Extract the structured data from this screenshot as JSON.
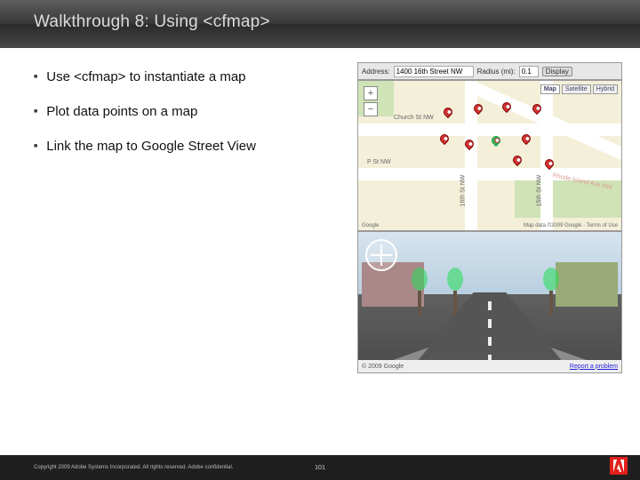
{
  "header": {
    "title": "Walkthrough 8: Using <cfmap>"
  },
  "bullets": [
    "Use <cfmap> to instantiate a map",
    "Plot data points on a map",
    "Link the map to Google Street View"
  ],
  "figure": {
    "addressBar": {
      "addrLabel": "Address:",
      "addrValue": "1400 16th Street NW",
      "radiusLabel": "Radius (mi):",
      "radiusValue": "0.1",
      "displayBtn": "Display"
    },
    "mapTypes": {
      "map": "Map",
      "satellite": "Satellite",
      "hybrid": "Hybrid"
    },
    "mapControls": {
      "plus": "+",
      "minus": "−"
    },
    "roads": {
      "church": "Church St NW",
      "pst": "P St NW",
      "sixteenth": "16th St NW",
      "fifteenth": "15th St NW",
      "rhode": "Rhode Island Ave NW"
    },
    "mapFooter": {
      "brand": "Google",
      "credits": "Map data ©2009 Google - Terms of Use"
    },
    "streetFooter": {
      "credit": "© 2009 Google",
      "report": "Report a problem"
    }
  },
  "footer": {
    "copyright": "Copyright 2009 Adobe Systems Incorporated.  All rights reserved.  Adobe confidential.",
    "page": "101"
  }
}
